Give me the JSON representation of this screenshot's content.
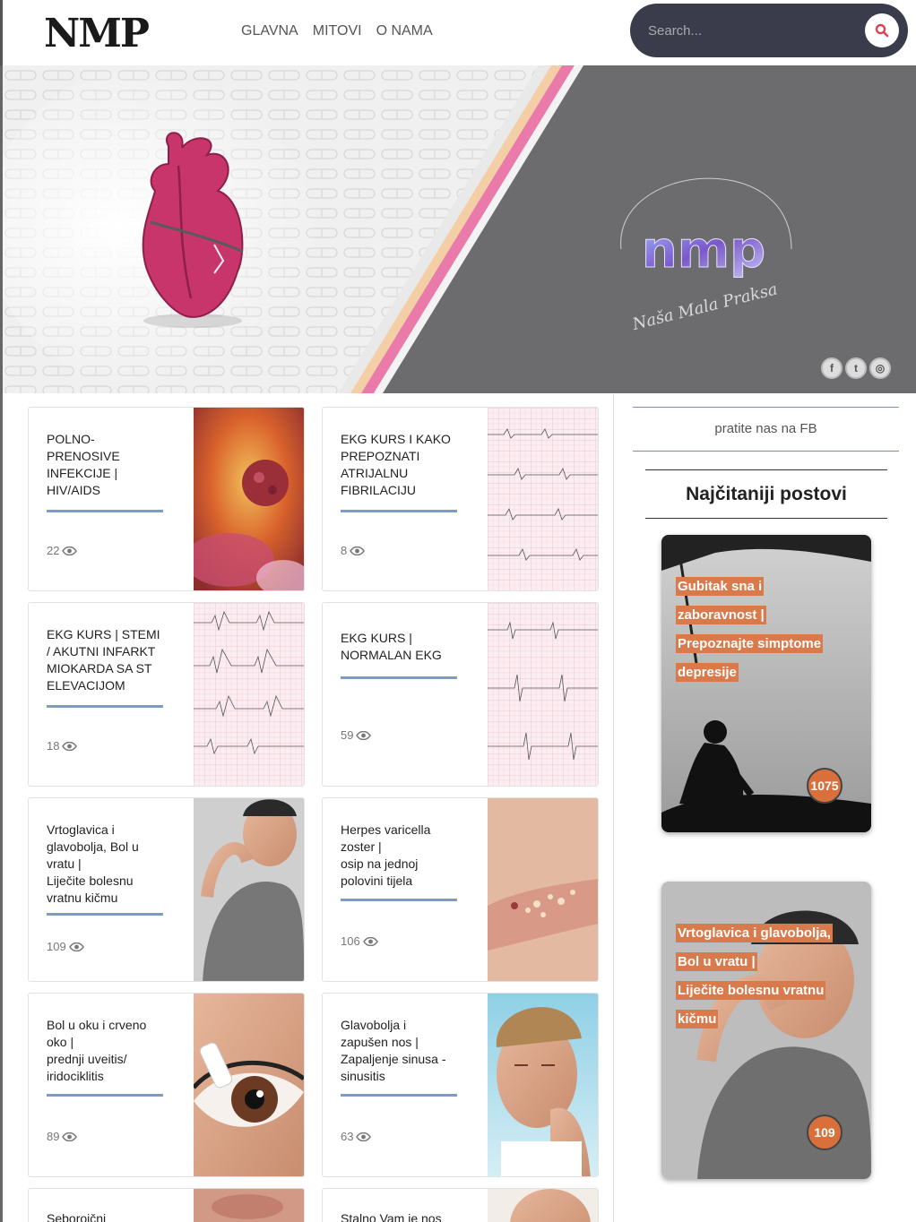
{
  "header": {
    "logo": "NMP",
    "nav": [
      "GLAVNA",
      "MITOVI",
      "O NAMA"
    ],
    "search_placeholder": "Search..."
  },
  "hero": {
    "brand": "nmp",
    "tagline": "Naša Mala Praksa",
    "social": [
      "f",
      "t",
      "◎"
    ]
  },
  "cards": [
    {
      "title": "POLNO-\nPRENOSIVE\nINFEKCIJE |\nHIV/AIDS",
      "views": "22"
    },
    {
      "title": "EKG KURS I KAKO\nPREPOZNATI\nATRIJALNU\nFIBRILACIJU",
      "views": "8"
    },
    {
      "title": "EKG KURS | STEMI\n/ AKUTNI INFARKT\nMIOKARDA SA ST\nELEVACIJOM",
      "views": "18"
    },
    {
      "title": "EKG KURS |\nNORMALAN EKG",
      "views": "59"
    },
    {
      "title": "Vrtoglavica i\nglavobolja, Bol u\nvratu |\nLiječite bolesnu\nvratnu kičmu",
      "views": "109"
    },
    {
      "title": "Herpes varicella\nzoster |\nosip na jednoj\npolovini tijela",
      "views": "106"
    },
    {
      "title": "Bol u oku i crveno\noko |\nprednji uveitis/\niridociklitis",
      "views": "89"
    },
    {
      "title": "Glavobolja i\nzapušen nos |\nZapaljenje sinusa -\nsinusitis",
      "views": "63"
    },
    {
      "title": "Seboroični",
      "views": ""
    },
    {
      "title": "Stalno Vam je nos",
      "views": ""
    }
  ],
  "sidebar": {
    "fb_text": "pratite nas na FB",
    "popular_title": "Najčitaniji postovi",
    "popular": [
      {
        "lines": [
          "Gubitak sna i",
          "zaboravnost |",
          "Prepoznajte simptome",
          "depresije"
        ],
        "count": "1075"
      },
      {
        "lines": [
          "Vrtoglavica i glavobolja,",
          "Bol u vratu |",
          "Liječite bolesnu vratnu",
          "kičmu"
        ],
        "count": "109"
      }
    ]
  }
}
